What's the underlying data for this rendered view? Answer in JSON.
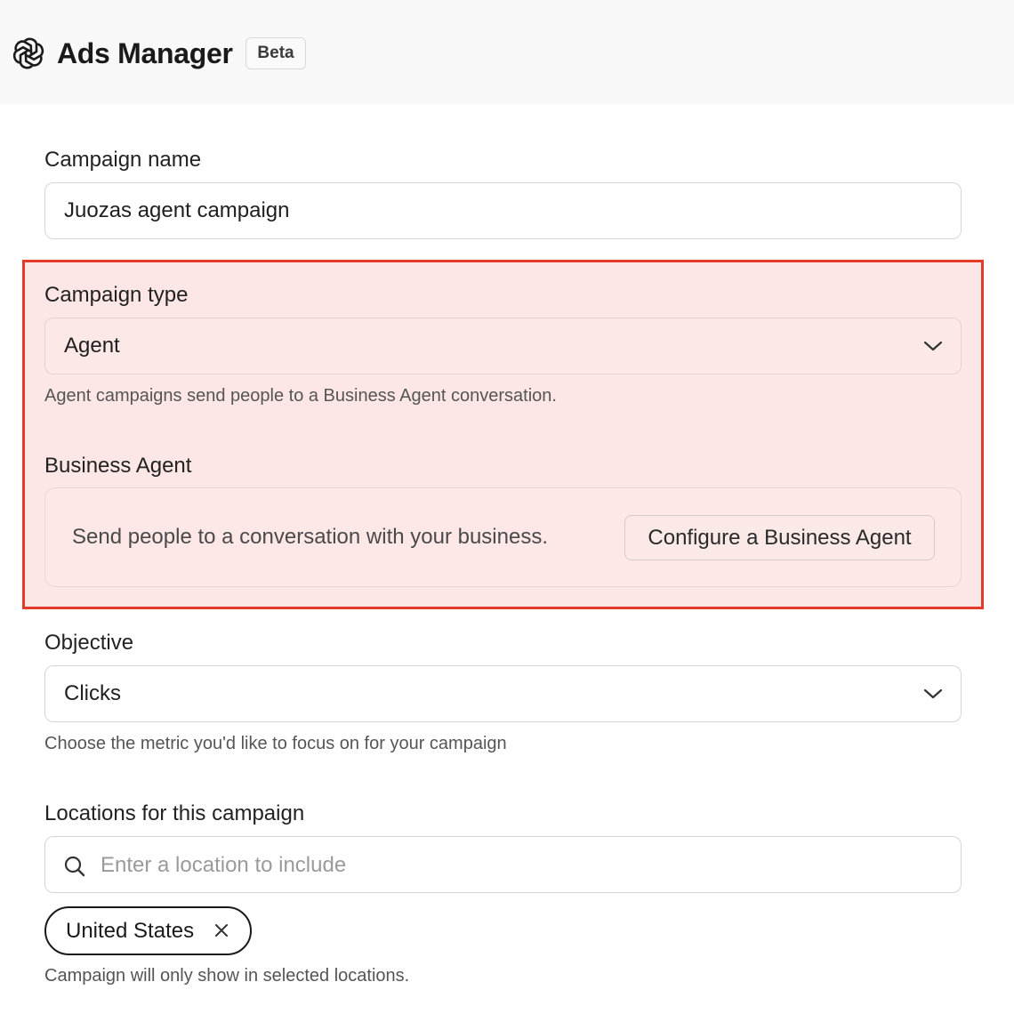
{
  "header": {
    "title": "Ads Manager",
    "badge": "Beta",
    "logo_icon": "openai-logo-icon"
  },
  "campaign_name": {
    "label": "Campaign name",
    "value": "Juozas agent campaign"
  },
  "campaign_type": {
    "label": "Campaign type",
    "selected": "Agent",
    "help": "Agent campaigns send people to a Business Agent conversation."
  },
  "business_agent": {
    "label": "Business Agent",
    "description": "Send people to a conversation with your business.",
    "button_label": "Configure a Business Agent"
  },
  "objective": {
    "label": "Objective",
    "selected": "Clicks",
    "help": "Choose the metric you'd like to focus on for your campaign"
  },
  "locations": {
    "label": "Locations for this campaign",
    "placeholder": "Enter a location to include",
    "chips": [
      "United States"
    ],
    "help": "Campaign will only show in selected locations."
  },
  "colors": {
    "highlight_border": "#e43a2a",
    "highlight_fill": "#fde7e6"
  }
}
